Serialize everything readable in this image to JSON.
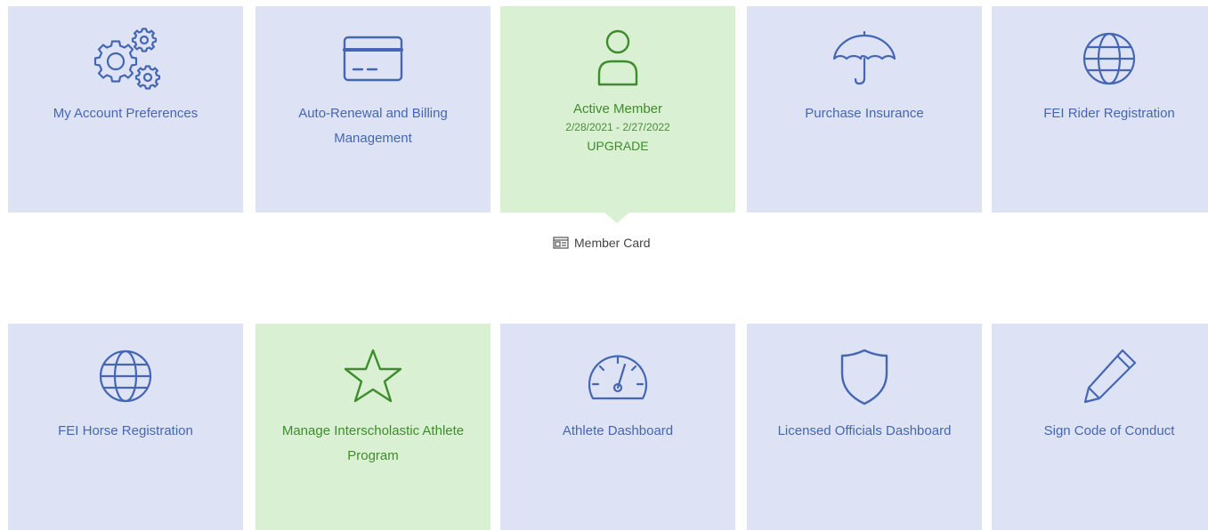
{
  "colors": {
    "tile_blue": "#dde3f4",
    "tile_green": "#d9f0d2",
    "text_blue": "#4566b3",
    "text_green": "#3f8c2e"
  },
  "tiles": [
    {
      "label": "My Account Preferences",
      "icon": "gears-icon"
    },
    {
      "label": "Auto-Renewal and Billing Management",
      "icon": "credit-card-icon"
    },
    {
      "label": "Active Member",
      "dates": "2/28/2021 - 2/27/2022",
      "action": "UPGRADE",
      "icon": "user-icon"
    },
    {
      "label": "Purchase Insurance",
      "icon": "umbrella-icon"
    },
    {
      "label": "FEI Rider Registration",
      "icon": "globe-icon"
    },
    {
      "label": "FEI Horse Registration",
      "icon": "globe-icon"
    },
    {
      "label": "Manage Interscholastic Athlete Program",
      "icon": "star-icon"
    },
    {
      "label": "Athlete Dashboard",
      "icon": "speedometer-icon"
    },
    {
      "label": "Licensed Officials Dashboard",
      "icon": "shield-icon"
    },
    {
      "label": "Sign Code of Conduct",
      "icon": "pencil-icon"
    }
  ],
  "member_card": {
    "label": "Member Card",
    "icon": "id-card-icon"
  }
}
